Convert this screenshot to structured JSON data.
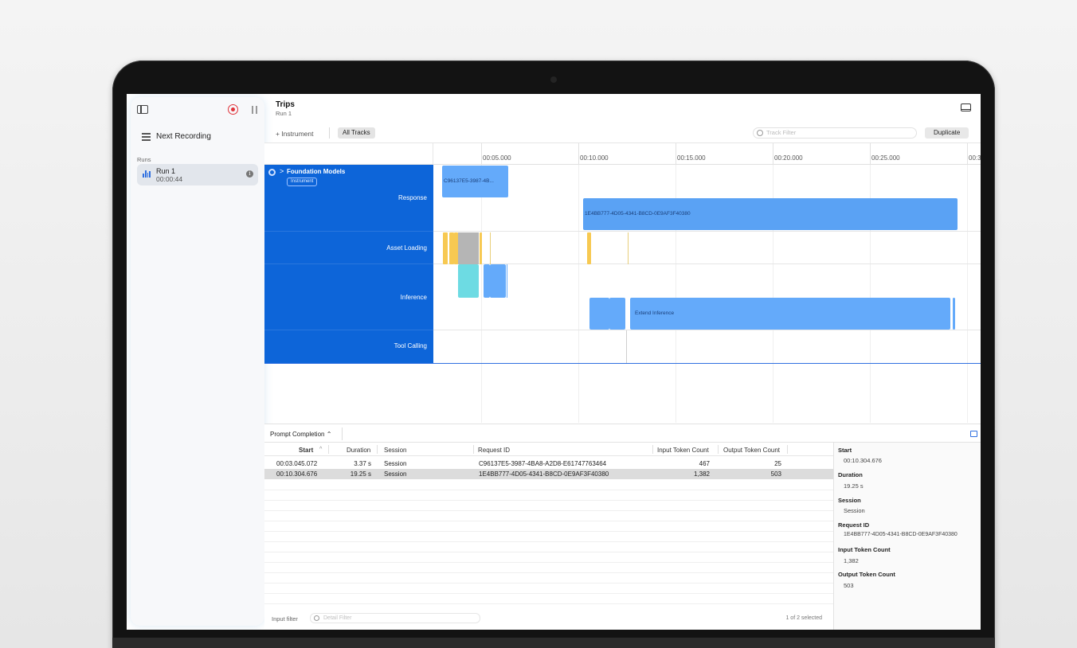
{
  "app": {
    "title": "Trips",
    "subtitle": "Run 1"
  },
  "sidebar": {
    "next_recording": "Next Recording",
    "runs_label": "Runs",
    "runs": [
      {
        "name": "Run 1",
        "duration": "00:00:44"
      }
    ],
    "info_glyph": "i"
  },
  "toolbar": {
    "add_instrument": "+ Instrument",
    "all_tracks": "All Tracks",
    "track_filter_placeholder": "Track Filter",
    "duplicate": "Duplicate"
  },
  "timeline": {
    "ticks": [
      "00:05.000",
      "00:10.000",
      "00:15.000",
      "00:20.000",
      "00:25.000",
      "00:3"
    ],
    "instrument_group": {
      "name": "Foundation Models",
      "badge": "Instrument",
      "chevron": ">"
    },
    "tracks": [
      "Response",
      "Asset Loading",
      "Inference",
      "Tool Calling"
    ],
    "bar_labels": {
      "response_1": "C96137E5-3987-4B...",
      "response_2": "1E4BB777-4D05-4341-B8CD-0E9AF3F40380",
      "extend_inference": "Extend Inference"
    }
  },
  "detail": {
    "selector": "Prompt Completion ⌃",
    "columns": [
      "Start",
      "Duration",
      "Session",
      "Request ID",
      "Input Token Count",
      "Output Token Count"
    ],
    "sort_indicator": "^",
    "rows": [
      {
        "start": "00:03.045.072",
        "duration": "3.37 s",
        "session": "Session",
        "request_id": "C96137E5-3987-4BA8-A2D8-E61747763464",
        "input_tokens": "467",
        "output_tokens": "25"
      },
      {
        "start": "00:10.304.676",
        "duration": "19.25 s",
        "session": "Session",
        "request_id": "1E4BB777-4D05-4341-B8CD-0E9AF3F40380",
        "input_tokens": "1,382",
        "output_tokens": "503"
      }
    ],
    "input_filter_label": "Input filter",
    "detail_filter_placeholder": "Detail Filter",
    "selected_count": "1 of 2 selected"
  },
  "inspector": {
    "fields": [
      {
        "label": "Start",
        "value": "00:10.304.676"
      },
      {
        "label": "Duration",
        "value": "19.25 s"
      },
      {
        "label": "Session",
        "value": "Session"
      },
      {
        "label": "Request ID",
        "value": "1E4BB777-4D05-4341-B8CD-0E9AF3F40380"
      },
      {
        "label": "Input Token Count",
        "value": "1,382"
      },
      {
        "label": "Output Token Count",
        "value": "503"
      }
    ]
  },
  "colors": {
    "accent": "#0d65d9",
    "bar": "#64aafa",
    "asset_yellow": "#f7c952",
    "inference_cyan": "#6ddbe3",
    "record_red": "#e0333a"
  }
}
